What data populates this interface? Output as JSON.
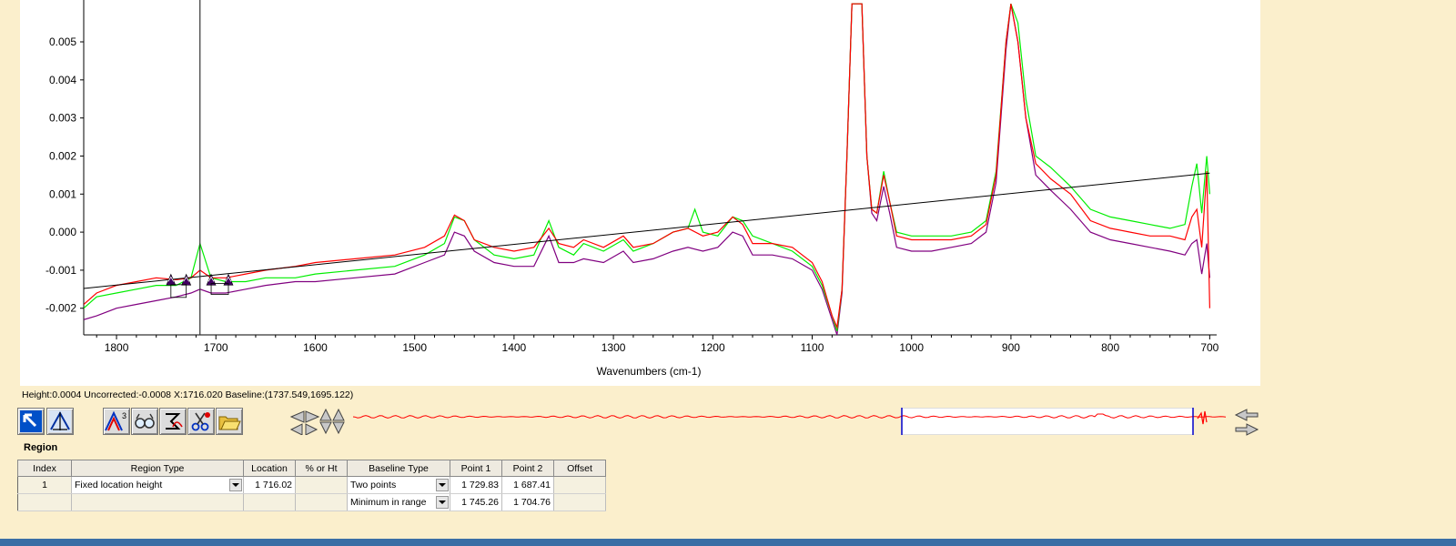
{
  "chart_data": {
    "type": "line",
    "xlabel": "Wavenumbers (cm-1)",
    "ylabel": "",
    "x_ticks": [
      1800,
      1700,
      1600,
      1500,
      1400,
      1300,
      1200,
      1100,
      1000,
      900,
      800,
      700
    ],
    "y_ticks": [
      0.005,
      0.004,
      0.003,
      0.002,
      0.001,
      0.0,
      -0.001,
      -0.002
    ],
    "y_tick_labels": [
      "0.005",
      "0.004",
      "0.003",
      "0.002",
      "0.001",
      "0.000",
      "-0.001",
      "-0.002"
    ],
    "x_tick_labels": [
      "1800",
      "1700",
      "1600",
      "1500",
      "1400",
      "1300",
      "1200",
      "1100",
      "1000",
      "900",
      "800",
      "700"
    ],
    "xlim": [
      1833,
      693
    ],
    "ylim": [
      -0.0027,
      0.0061
    ],
    "x_reversed": true,
    "cursor_x": 1716.02,
    "baseline": {
      "x": [
        1833,
        700
      ],
      "y": [
        -0.00148,
        0.00155
      ]
    },
    "series": [
      {
        "color": "#ff0000",
        "points": [
          [
            1833,
            -0.0019
          ],
          [
            1820,
            -0.0016
          ],
          [
            1800,
            -0.0014
          ],
          [
            1780,
            -0.0013
          ],
          [
            1760,
            -0.0012
          ],
          [
            1740,
            -0.00125
          ],
          [
            1725,
            -0.0012
          ],
          [
            1716,
            -0.001
          ],
          [
            1705,
            -0.0012
          ],
          [
            1690,
            -0.0012
          ],
          [
            1670,
            -0.0011
          ],
          [
            1650,
            -0.001
          ],
          [
            1620,
            -0.0009
          ],
          [
            1600,
            -0.0008
          ],
          [
            1560,
            -0.0007
          ],
          [
            1520,
            -0.0006
          ],
          [
            1490,
            -0.0004
          ],
          [
            1470,
            -0.0001
          ],
          [
            1460,
            0.00045
          ],
          [
            1450,
            0.0003
          ],
          [
            1440,
            -0.0002
          ],
          [
            1420,
            -0.0004
          ],
          [
            1400,
            -0.0005
          ],
          [
            1380,
            -0.0004
          ],
          [
            1365,
            0.0001
          ],
          [
            1355,
            -0.0003
          ],
          [
            1340,
            -0.0004
          ],
          [
            1330,
            -0.0002
          ],
          [
            1310,
            -0.0004
          ],
          [
            1290,
            -0.0001
          ],
          [
            1280,
            -0.0004
          ],
          [
            1260,
            -0.0003
          ],
          [
            1240,
            0.0
          ],
          [
            1225,
            0.0001
          ],
          [
            1210,
            -0.0001
          ],
          [
            1195,
            0.0
          ],
          [
            1180,
            0.0004
          ],
          [
            1170,
            0.0002
          ],
          [
            1160,
            -0.0003
          ],
          [
            1140,
            -0.0003
          ],
          [
            1120,
            -0.0004
          ],
          [
            1100,
            -0.0008
          ],
          [
            1090,
            -0.0013
          ],
          [
            1080,
            -0.0022
          ],
          [
            1075,
            -0.0025
          ],
          [
            1070,
            -0.0015
          ],
          [
            1065,
            0.002
          ],
          [
            1060,
            0.006
          ],
          [
            1050,
            0.006
          ],
          [
            1045,
            0.002
          ],
          [
            1040,
            0.0006
          ],
          [
            1035,
            0.0005
          ],
          [
            1028,
            0.0015
          ],
          [
            1022,
            0.0008
          ],
          [
            1015,
            -0.0001
          ],
          [
            1000,
            -0.0002
          ],
          [
            980,
            -0.0002
          ],
          [
            960,
            -0.0002
          ],
          [
            940,
            -0.0001
          ],
          [
            925,
            0.0002
          ],
          [
            915,
            0.0015
          ],
          [
            905,
            0.005
          ],
          [
            900,
            0.006
          ],
          [
            893,
            0.005
          ],
          [
            885,
            0.003
          ],
          [
            875,
            0.0018
          ],
          [
            860,
            0.0014
          ],
          [
            840,
            0.001
          ],
          [
            820,
            0.0003
          ],
          [
            800,
            0.0001
          ],
          [
            780,
            0.0
          ],
          [
            760,
            -0.0001
          ],
          [
            740,
            -0.0001
          ],
          [
            725,
            -0.0002
          ],
          [
            718,
            0.0004
          ],
          [
            713,
            0.0006
          ],
          [
            708,
            -0.0004
          ],
          [
            703,
            0.0016
          ],
          [
            700,
            -0.002
          ]
        ]
      },
      {
        "color": "#00ee00",
        "points": [
          [
            1833,
            -0.002
          ],
          [
            1820,
            -0.0017
          ],
          [
            1800,
            -0.0016
          ],
          [
            1780,
            -0.0015
          ],
          [
            1760,
            -0.0014
          ],
          [
            1740,
            -0.0014
          ],
          [
            1725,
            -0.0012
          ],
          [
            1716,
            -0.0003
          ],
          [
            1705,
            -0.0012
          ],
          [
            1690,
            -0.0013
          ],
          [
            1670,
            -0.0013
          ],
          [
            1650,
            -0.0012
          ],
          [
            1620,
            -0.0012
          ],
          [
            1600,
            -0.0011
          ],
          [
            1560,
            -0.001
          ],
          [
            1520,
            -0.0009
          ],
          [
            1490,
            -0.0006
          ],
          [
            1470,
            -0.0003
          ],
          [
            1460,
            0.0004
          ],
          [
            1450,
            0.0003
          ],
          [
            1440,
            -0.0002
          ],
          [
            1420,
            -0.0006
          ],
          [
            1400,
            -0.0007
          ],
          [
            1380,
            -0.0006
          ],
          [
            1365,
            0.0003
          ],
          [
            1355,
            -0.0004
          ],
          [
            1340,
            -0.0006
          ],
          [
            1330,
            -0.0003
          ],
          [
            1310,
            -0.0005
          ],
          [
            1290,
            -0.0002
          ],
          [
            1280,
            -0.0005
          ],
          [
            1260,
            -0.0003
          ],
          [
            1240,
            0.0
          ],
          [
            1225,
            0.0001
          ],
          [
            1218,
            0.0006
          ],
          [
            1210,
            0.0
          ],
          [
            1195,
            -0.0001
          ],
          [
            1180,
            0.0004
          ],
          [
            1170,
            0.0003
          ],
          [
            1160,
            -0.0001
          ],
          [
            1140,
            -0.0003
          ],
          [
            1120,
            -0.0005
          ],
          [
            1100,
            -0.0009
          ],
          [
            1090,
            -0.0014
          ],
          [
            1080,
            -0.0022
          ],
          [
            1075,
            -0.0026
          ],
          [
            1070,
            -0.0015
          ],
          [
            1065,
            0.002
          ],
          [
            1060,
            0.006
          ],
          [
            1050,
            0.006
          ],
          [
            1045,
            0.002
          ],
          [
            1040,
            0.0006
          ],
          [
            1035,
            0.0005
          ],
          [
            1028,
            0.0016
          ],
          [
            1022,
            0.0008
          ],
          [
            1015,
            0.0
          ],
          [
            1000,
            -0.0001
          ],
          [
            980,
            -0.0001
          ],
          [
            960,
            -0.0001
          ],
          [
            940,
            0.0
          ],
          [
            925,
            0.0003
          ],
          [
            915,
            0.0016
          ],
          [
            905,
            0.005
          ],
          [
            900,
            0.006
          ],
          [
            893,
            0.0055
          ],
          [
            885,
            0.0035
          ],
          [
            875,
            0.002
          ],
          [
            860,
            0.0017
          ],
          [
            840,
            0.0012
          ],
          [
            820,
            0.0006
          ],
          [
            800,
            0.0004
          ],
          [
            780,
            0.0003
          ],
          [
            760,
            0.0002
          ],
          [
            740,
            0.0001
          ],
          [
            725,
            0.0002
          ],
          [
            718,
            0.0012
          ],
          [
            713,
            0.0018
          ],
          [
            708,
            0.0005
          ],
          [
            703,
            0.002
          ],
          [
            700,
            0.001
          ]
        ]
      },
      {
        "color": "#800080",
        "points": [
          [
            1833,
            -0.0023
          ],
          [
            1820,
            -0.0022
          ],
          [
            1800,
            -0.002
          ],
          [
            1780,
            -0.0019
          ],
          [
            1760,
            -0.0018
          ],
          [
            1740,
            -0.0017
          ],
          [
            1725,
            -0.0016
          ],
          [
            1716,
            -0.0015
          ],
          [
            1705,
            -0.0016
          ],
          [
            1690,
            -0.0016
          ],
          [
            1670,
            -0.0015
          ],
          [
            1650,
            -0.0014
          ],
          [
            1620,
            -0.0013
          ],
          [
            1600,
            -0.0013
          ],
          [
            1560,
            -0.0012
          ],
          [
            1520,
            -0.0011
          ],
          [
            1490,
            -0.0008
          ],
          [
            1470,
            -0.0006
          ],
          [
            1460,
            0.0
          ],
          [
            1450,
            -0.0001
          ],
          [
            1440,
            -0.0005
          ],
          [
            1420,
            -0.0008
          ],
          [
            1400,
            -0.0009
          ],
          [
            1380,
            -0.0009
          ],
          [
            1365,
            -0.0001
          ],
          [
            1355,
            -0.0008
          ],
          [
            1340,
            -0.0008
          ],
          [
            1330,
            -0.0007
          ],
          [
            1310,
            -0.0008
          ],
          [
            1290,
            -0.0005
          ],
          [
            1280,
            -0.0008
          ],
          [
            1260,
            -0.0007
          ],
          [
            1240,
            -0.0005
          ],
          [
            1225,
            -0.0004
          ],
          [
            1210,
            -0.0005
          ],
          [
            1195,
            -0.0004
          ],
          [
            1180,
            0.0
          ],
          [
            1170,
            -0.0001
          ],
          [
            1160,
            -0.0006
          ],
          [
            1140,
            -0.0006
          ],
          [
            1120,
            -0.0007
          ],
          [
            1100,
            -0.001
          ],
          [
            1090,
            -0.0015
          ],
          [
            1080,
            -0.0023
          ],
          [
            1075,
            -0.0027
          ],
          [
            1070,
            -0.0016
          ],
          [
            1065,
            0.002
          ],
          [
            1060,
            0.006
          ],
          [
            1050,
            0.006
          ],
          [
            1045,
            0.002
          ],
          [
            1040,
            0.0005
          ],
          [
            1035,
            0.0003
          ],
          [
            1028,
            0.0012
          ],
          [
            1022,
            0.0005
          ],
          [
            1015,
            -0.0004
          ],
          [
            1000,
            -0.0005
          ],
          [
            980,
            -0.0005
          ],
          [
            960,
            -0.0004
          ],
          [
            940,
            -0.0003
          ],
          [
            925,
            0.0
          ],
          [
            915,
            0.0013
          ],
          [
            905,
            0.0048
          ],
          [
            900,
            0.006
          ],
          [
            893,
            0.005
          ],
          [
            885,
            0.003
          ],
          [
            875,
            0.0015
          ],
          [
            860,
            0.0011
          ],
          [
            840,
            0.0006
          ],
          [
            820,
            0.0
          ],
          [
            800,
            -0.0002
          ],
          [
            780,
            -0.0003
          ],
          [
            760,
            -0.0004
          ],
          [
            740,
            -0.0005
          ],
          [
            725,
            -0.0006
          ],
          [
            718,
            -0.0003
          ],
          [
            713,
            -0.0002
          ],
          [
            708,
            -0.0011
          ],
          [
            703,
            -0.0003
          ],
          [
            700,
            -0.0012
          ]
        ]
      }
    ],
    "markers_x": [
      1745.26,
      1729.83,
      1704.76,
      1687.41
    ]
  },
  "status": {
    "text": "Height:0.0004 Uncorrected:-0.0008 X:1716.020 Baseline:(1737.549,1695.122)"
  },
  "toolbar": {
    "icons": [
      "pointer-arrow-icon",
      "peak-marker-icon",
      "peak-analysis-icon",
      "eyeglasses-icon",
      "sigma-icon",
      "scissors-icon",
      "open-folder-icon",
      "expand-horizontal-icon",
      "expand-vertical-icon",
      "scroll-arrows-icon"
    ],
    "accent": "#0000cc"
  },
  "region": {
    "title": "Region",
    "columns": [
      "Index",
      "Region Type",
      "Location",
      "% or Ht",
      "Baseline Type",
      "Point 1",
      "Point 2",
      "Offset"
    ],
    "rows": [
      {
        "index": "1",
        "region_type": "Fixed location height",
        "location": "1 716.02",
        "pct_or_ht": "",
        "baseline_type": "Two points",
        "point1": "1 729.83",
        "point2": "1 687.41",
        "offset": ""
      },
      {
        "index": "",
        "region_type": "",
        "location": "",
        "pct_or_ht": "",
        "baseline_type": "Minimum in range",
        "point1": "1 745.26",
        "point2": "1 704.76",
        "offset": ""
      }
    ]
  }
}
